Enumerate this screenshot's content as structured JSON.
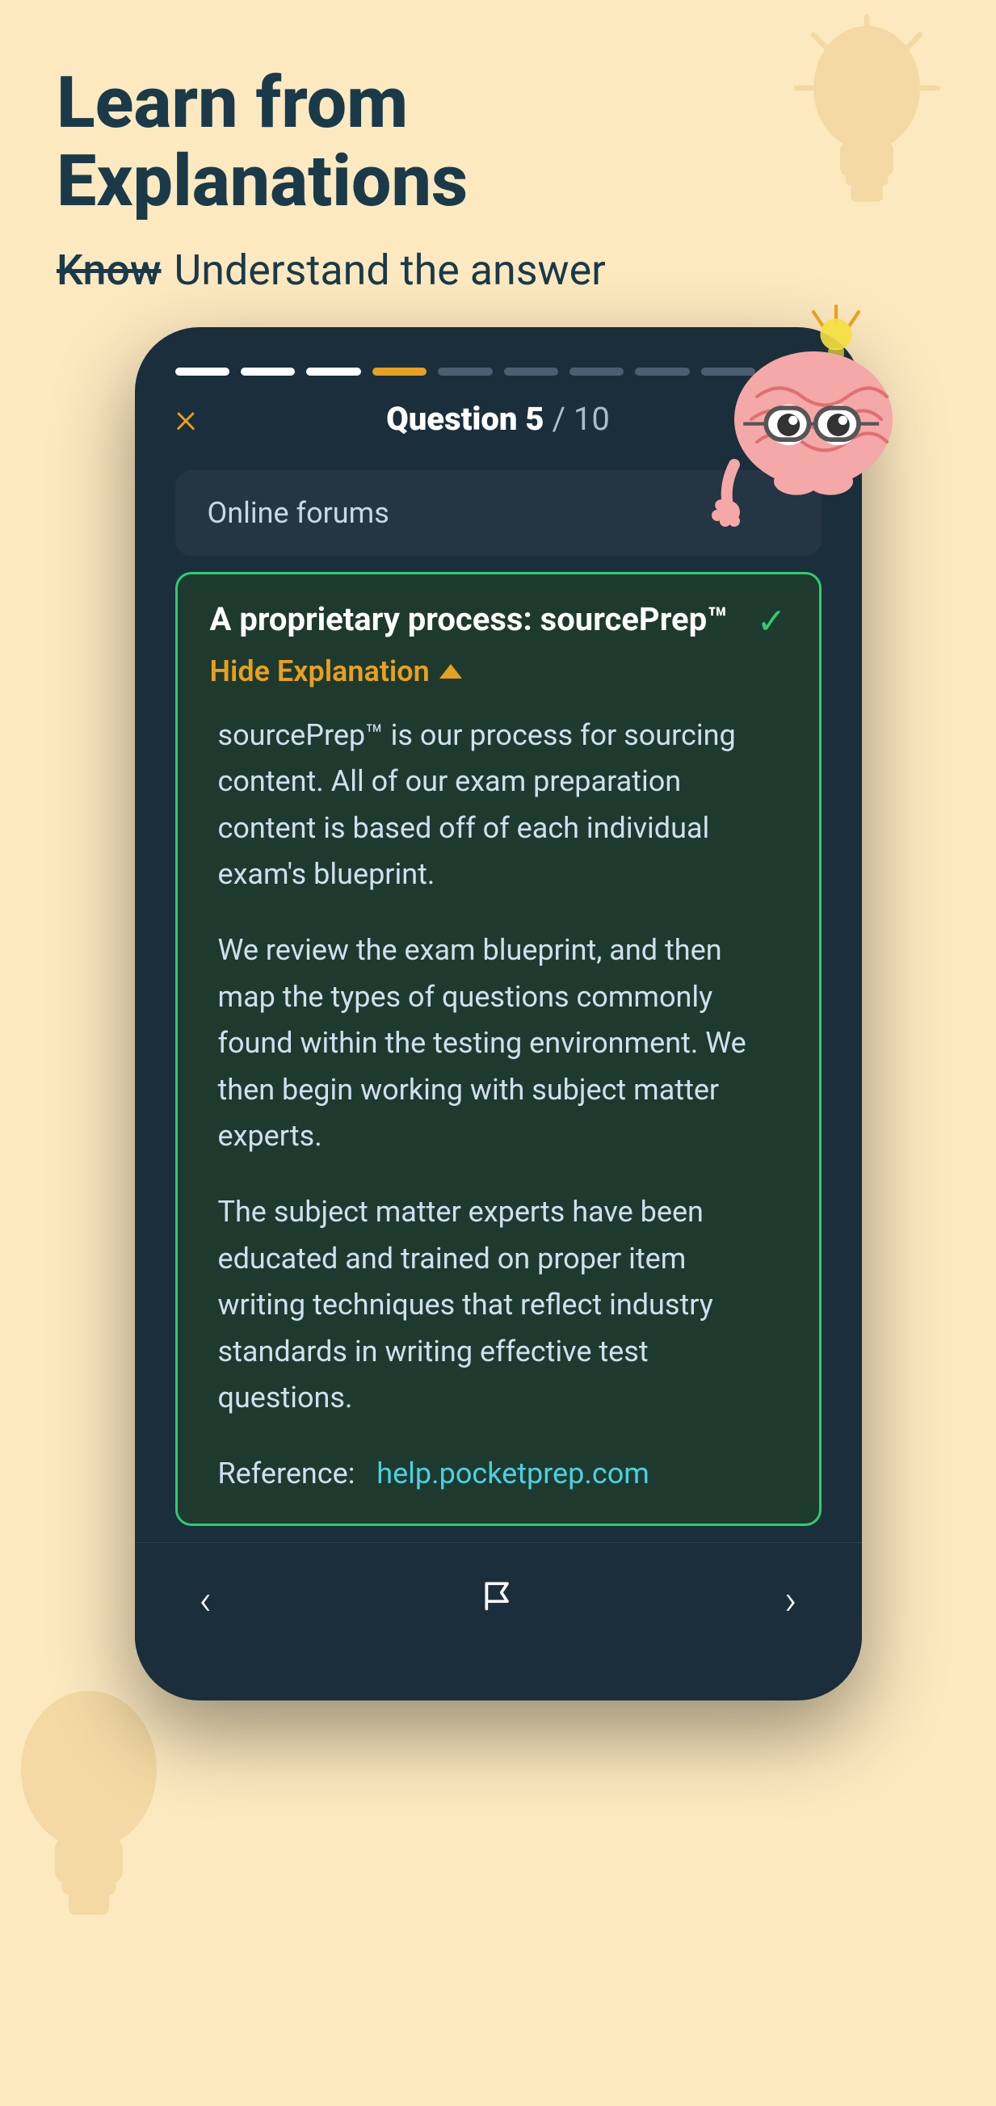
{
  "header": {
    "title": "Learn from\nExplanations",
    "subtitle_strikethrough": "Know",
    "subtitle_text": "Understand the answer"
  },
  "progress": {
    "bars": [
      {
        "state": "completed"
      },
      {
        "state": "completed"
      },
      {
        "state": "completed"
      },
      {
        "state": "active"
      },
      {
        "state": "inactive"
      },
      {
        "state": "inactive"
      },
      {
        "state": "inactive"
      },
      {
        "state": "inactive"
      },
      {
        "state": "inactive"
      },
      {
        "state": "inactive"
      }
    ]
  },
  "question": {
    "close_label": "×",
    "number_label": "Question 5",
    "total_label": "/ 10"
  },
  "prev_answer": {
    "text": "Online forums"
  },
  "correct_answer": {
    "text": "A proprietary process: sourcePrep™",
    "hide_explanation_label": "Hide Explanation"
  },
  "explanation": {
    "paragraph1": "sourcePrep™ is our process for sourcing content. All of our exam preparation content is based off of each individual exam's blueprint.",
    "paragraph2": "We review the exam blueprint, and then map the types of questions commonly found within the testing environment. We then begin working with subject matter experts.",
    "paragraph3": "The subject matter experts have been educated and trained on proper item writing techniques that reflect industry standards in writing effective test questions.",
    "reference_label": "Reference:",
    "reference_link": "help.pocketprep.com"
  },
  "bottom_nav": {
    "back_label": "‹",
    "forward_label": "›"
  },
  "colors": {
    "background": "#fde9c0",
    "phone_bg": "#1a2e3b",
    "accent_orange": "#e8a020",
    "accent_green": "#2ecc71",
    "text_white": "#ffffff",
    "text_muted": "#c8d8e8"
  }
}
